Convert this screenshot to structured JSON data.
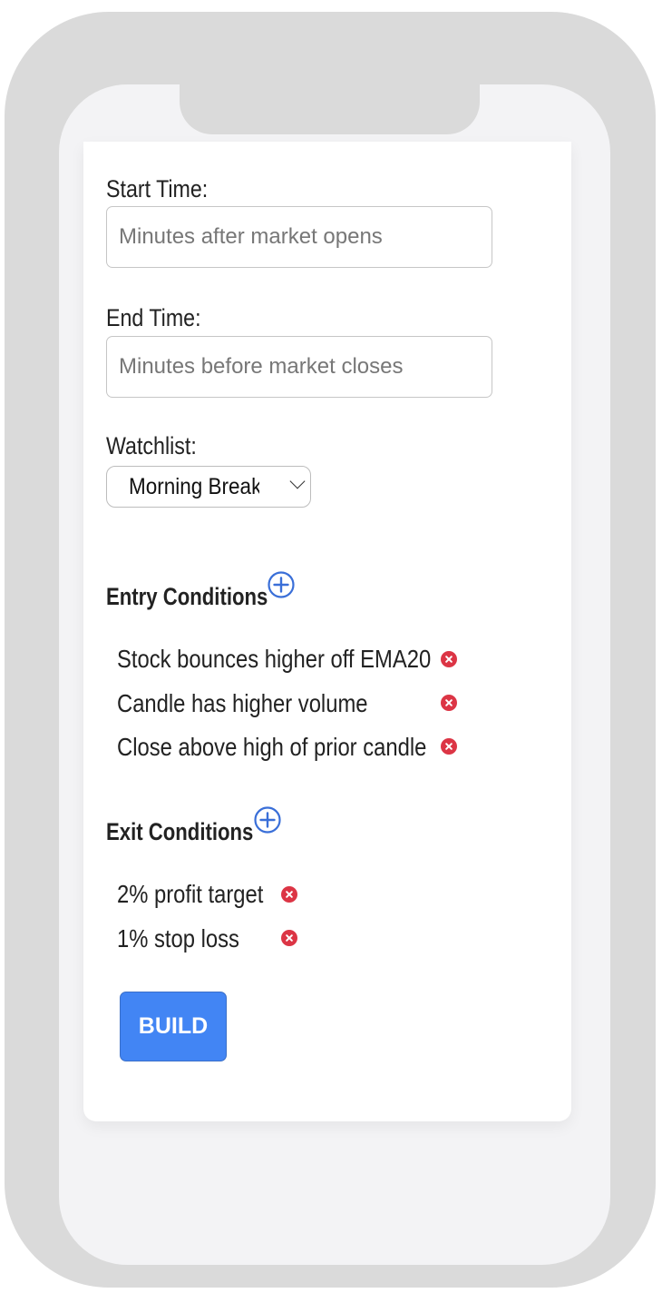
{
  "form": {
    "start_time": {
      "label": "Start Time:",
      "placeholder": "Minutes after market opens",
      "value": ""
    },
    "end_time": {
      "label": "End Time:",
      "placeholder": "Minutes before market closes",
      "value": ""
    },
    "watchlist": {
      "label": "Watchlist:",
      "selected": "Morning Breakout"
    }
  },
  "entry_conditions": {
    "title": "Entry Conditions",
    "add_icon": "plus-circle-icon",
    "remove_icon": "x-circle-icon",
    "items": [
      "Stock bounces higher off EMA20",
      "Candle has higher volume",
      "Close above high of prior candle"
    ]
  },
  "exit_conditions": {
    "title": "Exit Conditions",
    "add_icon": "plus-circle-icon",
    "remove_icon": "x-circle-icon",
    "items": [
      "2% profit target",
      "1% stop loss"
    ]
  },
  "actions": {
    "build_label": "BUILD"
  },
  "colors": {
    "primary": "#4285f4",
    "add_icon": "#3a6fd8",
    "remove_icon": "#dc3545",
    "frame": "#dadada"
  }
}
